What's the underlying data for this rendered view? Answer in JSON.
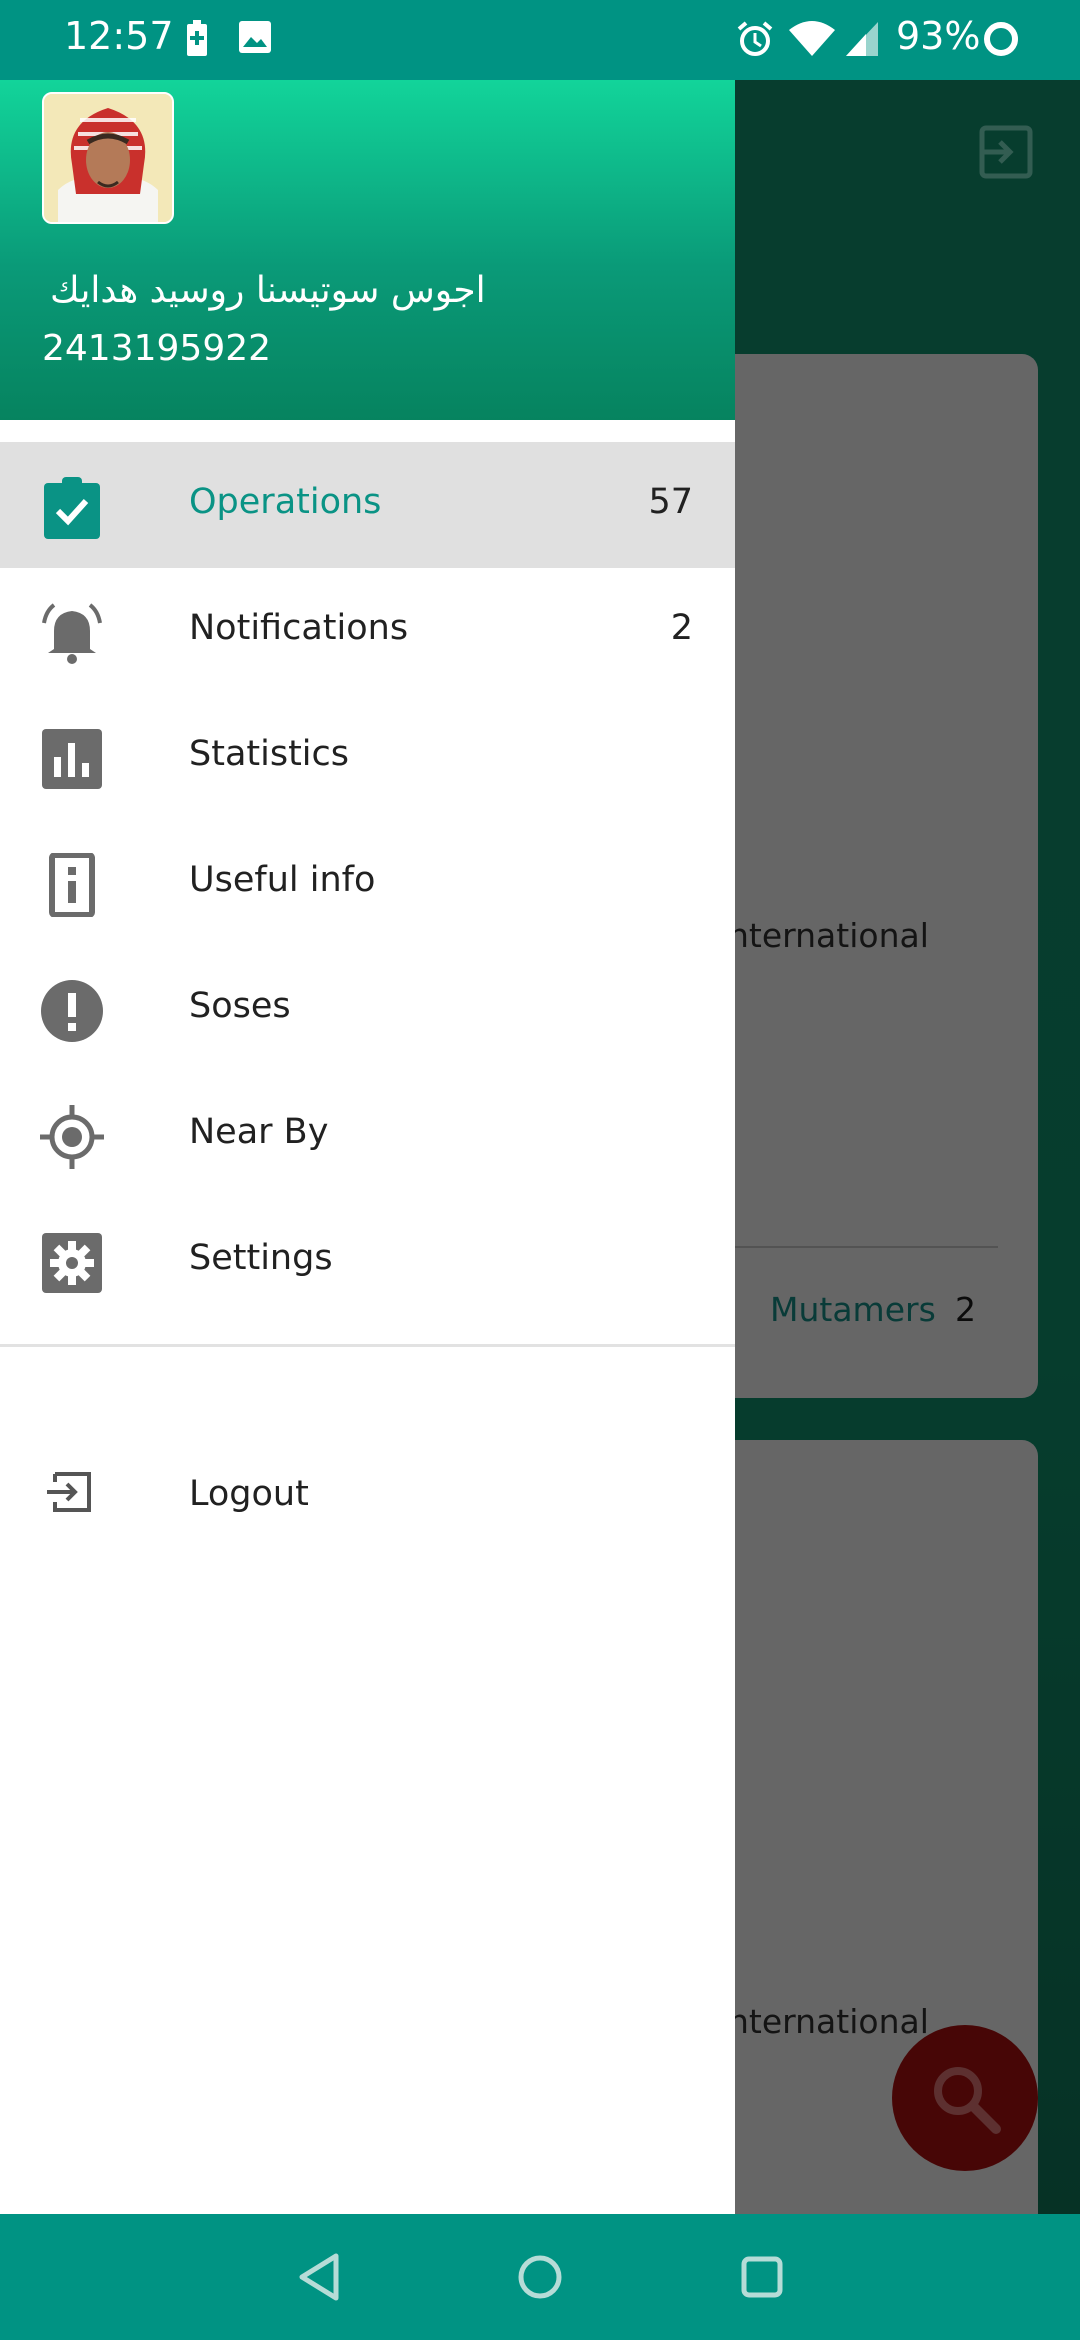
{
  "status_bar": {
    "time": "12:57",
    "battery_percent": "93%",
    "icons": [
      "battery-charging-icon",
      "image-icon",
      "alarm-icon",
      "wifi-icon",
      "signal-icon",
      "battery-ring-icon"
    ]
  },
  "background": {
    "card1": {
      "text": "nternational",
      "mutamers_label": "Mutamers",
      "mutamers_count": "2"
    },
    "card2": {
      "text": "nternational"
    },
    "fab_icon": "search-icon",
    "top_icon": "logout-icon"
  },
  "drawer": {
    "header": {
      "user_name": "اجوس سوتيسنا روسيد هدايك",
      "user_id": "2413195922"
    },
    "items": [
      {
        "label": "Operations",
        "count": "57",
        "icon": "clipboard-check-icon",
        "active": true
      },
      {
        "label": "Notifications",
        "count": "2",
        "icon": "bell-icon"
      },
      {
        "label": "Statistics",
        "count": "",
        "icon": "bar-chart-icon"
      },
      {
        "label": "Useful info",
        "count": "",
        "icon": "info-icon"
      },
      {
        "label": "Soses",
        "count": "",
        "icon": "alert-icon"
      },
      {
        "label": "Near By",
        "count": "",
        "icon": "gps-target-icon"
      },
      {
        "label": "Settings",
        "count": "",
        "icon": "gear-icon"
      }
    ],
    "logout": {
      "label": "Logout",
      "icon": "logout-icon"
    }
  },
  "colors": {
    "primary": "#009383",
    "header_gradient_top": "#12d49a",
    "header_gradient_bottom": "#06835f",
    "active_text": "#0a9385",
    "icon_gray": "#6b6b6b",
    "fab": "#6e0a0a"
  }
}
